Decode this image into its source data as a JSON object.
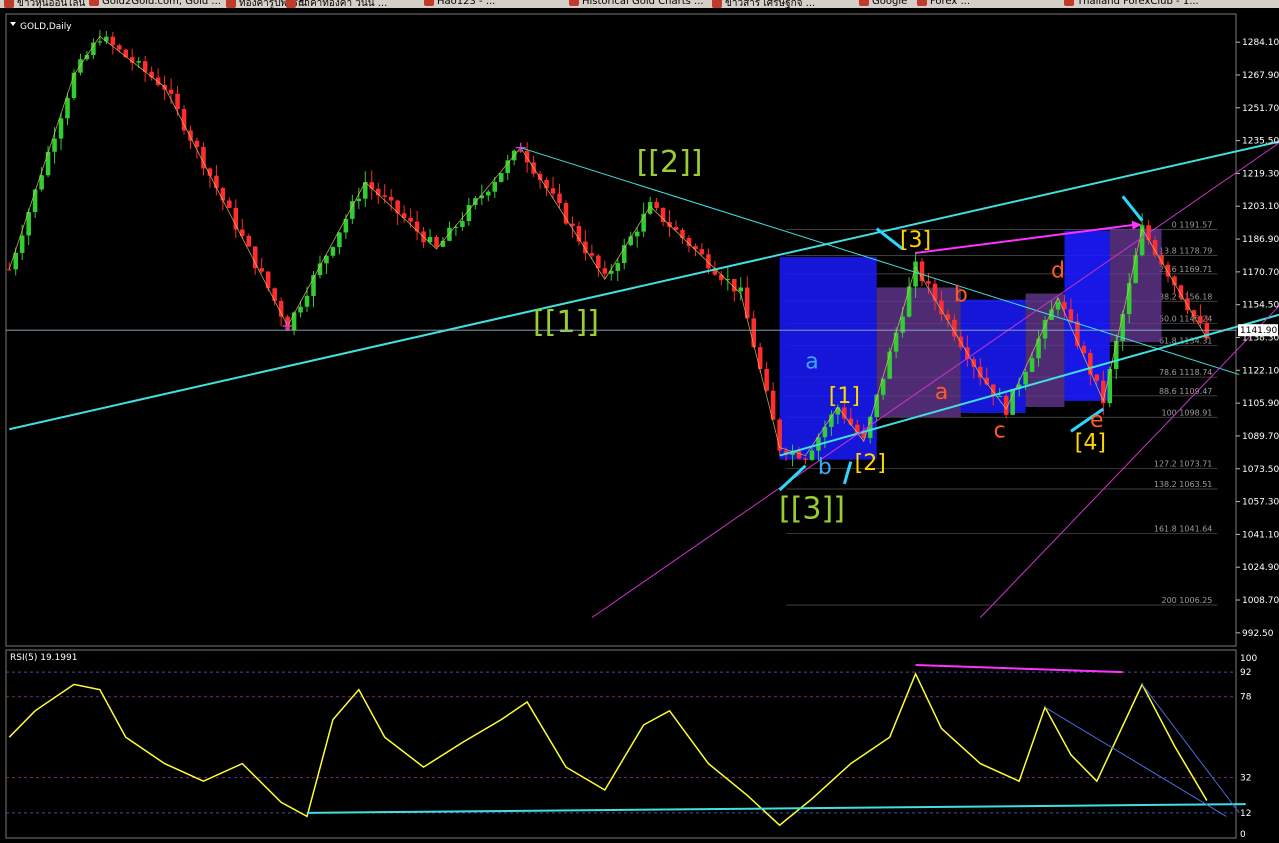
{
  "bookmarks": [
    "ข่าวหุ้นออนไลน์",
    "Gold2Gold.com, Gold ...",
    "ทองคำรูปพรรณ",
    "ราคาทองคำ วันนี้ ...",
    "Hao123 - ...",
    "Historical Gold Charts ...",
    "ข่าวสาร เศรษฐกิจ ...",
    "Google",
    "Forex ...",
    "Thailand ForexClub - 1..."
  ],
  "chart_data": [
    {
      "type": "candlestick",
      "title": "GOLD,Daily",
      "ylim": [
        986,
        1298
      ],
      "y_ticks": [
        "1284.10",
        "1267.90",
        "1251.70",
        "1235.50",
        "1219.30",
        "1203.10",
        "1186.90",
        "1170.70",
        "1154.50",
        "1138.30",
        "1122.10",
        "1105.90",
        "1089.70",
        "1073.50",
        "1057.30",
        "1041.10",
        "1024.90",
        "1008.70",
        "992.50"
      ],
      "current_price": "1141.90",
      "current_price_value": 1141.9,
      "wave_path": [
        {
          "t": 0,
          "p": 1172
        },
        {
          "t": 10,
          "p": 1268
        },
        {
          "t": 14,
          "p": 1287
        },
        {
          "t": 24,
          "p": 1262
        },
        {
          "t": 43,
          "p": 1144
        },
        {
          "t": 55,
          "p": 1215
        },
        {
          "t": 66,
          "p": 1182
        },
        {
          "t": 79,
          "p": 1232
        },
        {
          "t": 92,
          "p": 1167
        },
        {
          "t": 99,
          "p": 1203
        },
        {
          "t": 113,
          "p": 1160
        },
        {
          "t": 119,
          "p": 1084
        },
        {
          "t": 123,
          "p": 1080
        },
        {
          "t": 128,
          "p": 1104
        },
        {
          "t": 132,
          "p": 1087
        },
        {
          "t": 140,
          "p": 1173
        },
        {
          "t": 150,
          "p": 1120
        },
        {
          "t": 154,
          "p": 1103
        },
        {
          "t": 162,
          "p": 1158
        },
        {
          "t": 169,
          "p": 1107
        },
        {
          "t": 175,
          "p": 1192
        },
        {
          "t": 185,
          "p": 1138
        }
      ],
      "wave_labels": [
        {
          "text": "[[1]]",
          "color": "#9acd32",
          "t": 86,
          "p": 1141
        },
        {
          "text": "[[2]]",
          "color": "#9acd32",
          "t": 102,
          "p": 1220
        },
        {
          "text": "[[3]]",
          "color": "#9acd32",
          "t": 124,
          "p": 1049
        },
        {
          "text": "a",
          "color": "#3ea6ff",
          "t": 124,
          "p": 1123
        },
        {
          "text": "b",
          "color": "#3ea6ff",
          "t": 126,
          "p": 1071
        },
        {
          "text": "[1]",
          "color": "#ffd700",
          "t": 129,
          "p": 1106
        },
        {
          "text": "[2]",
          "color": "#ffd700",
          "t": 133,
          "p": 1073
        },
        {
          "text": "[3]",
          "color": "#ffd700",
          "t": 140,
          "p": 1183
        },
        {
          "text": "[4]",
          "color": "#ffd700",
          "t": 167,
          "p": 1083
        },
        {
          "text": "a",
          "color": "#ff5a1f",
          "t": 144,
          "p": 1108
        },
        {
          "text": "b",
          "color": "#ff5a1f",
          "t": 147,
          "p": 1156
        },
        {
          "text": "c",
          "color": "#ff5a1f",
          "t": 153,
          "p": 1089
        },
        {
          "text": "d",
          "color": "#ff5a1f",
          "t": 162,
          "p": 1168
        },
        {
          "text": "e",
          "color": "#ff5a1f",
          "t": 168,
          "p": 1094
        }
      ],
      "fib_levels": [
        {
          "label": "0 1191.57",
          "price": 1191.57
        },
        {
          "label": "13.8 1178.79",
          "price": 1178.79
        },
        {
          "label": "23.6 1169.71",
          "price": 1169.71
        },
        {
          "label": "38.2 1156.18",
          "price": 1156.18
        },
        {
          "label": "50.0 1145.24",
          "price": 1145.24
        },
        {
          "label": "61.8 1134.31",
          "price": 1134.31
        },
        {
          "label": "78.6 1118.74",
          "price": 1118.74
        },
        {
          "label": "88.6 1109.47",
          "price": 1109.47
        },
        {
          "label": "100 1098.91",
          "price": 1098.91
        },
        {
          "label": "127.2 1073.71",
          "price": 1073.71
        },
        {
          "label": "138.2 1063.51",
          "price": 1063.51
        },
        {
          "label": "161.8 1041.64",
          "price": 1041.64
        },
        {
          "label": "200 1006.25",
          "price": 1006.25
        }
      ]
    },
    {
      "type": "line",
      "title": "RSI(5) 19.1991",
      "ylim": [
        0,
        100
      ],
      "levels": [
        "100",
        "92",
        "78",
        "32",
        "12",
        "0"
      ],
      "series": [
        {
          "name": "RSI(5)",
          "color": "#ffff33",
          "points": [
            {
              "t": 0,
              "v": 55
            },
            {
              "t": 4,
              "v": 70
            },
            {
              "t": 10,
              "v": 85
            },
            {
              "t": 14,
              "v": 82
            },
            {
              "t": 18,
              "v": 55
            },
            {
              "t": 24,
              "v": 40
            },
            {
              "t": 30,
              "v": 30
            },
            {
              "t": 36,
              "v": 40
            },
            {
              "t": 42,
              "v": 18
            },
            {
              "t": 46,
              "v": 10
            },
            {
              "t": 50,
              "v": 65
            },
            {
              "t": 54,
              "v": 82
            },
            {
              "t": 58,
              "v": 55
            },
            {
              "t": 64,
              "v": 38
            },
            {
              "t": 70,
              "v": 52
            },
            {
              "t": 76,
              "v": 65
            },
            {
              "t": 80,
              "v": 75
            },
            {
              "t": 86,
              "v": 38
            },
            {
              "t": 92,
              "v": 25
            },
            {
              "t": 98,
              "v": 62
            },
            {
              "t": 102,
              "v": 70
            },
            {
              "t": 108,
              "v": 40
            },
            {
              "t": 114,
              "v": 22
            },
            {
              "t": 119,
              "v": 5
            },
            {
              "t": 124,
              "v": 20
            },
            {
              "t": 130,
              "v": 40
            },
            {
              "t": 136,
              "v": 55
            },
            {
              "t": 140,
              "v": 91
            },
            {
              "t": 144,
              "v": 60
            },
            {
              "t": 150,
              "v": 40
            },
            {
              "t": 156,
              "v": 30
            },
            {
              "t": 160,
              "v": 72
            },
            {
              "t": 164,
              "v": 45
            },
            {
              "t": 168,
              "v": 30
            },
            {
              "t": 175,
              "v": 85
            },
            {
              "t": 180,
              "v": 50
            },
            {
              "t": 185,
              "v": 19
            }
          ]
        }
      ]
    }
  ]
}
